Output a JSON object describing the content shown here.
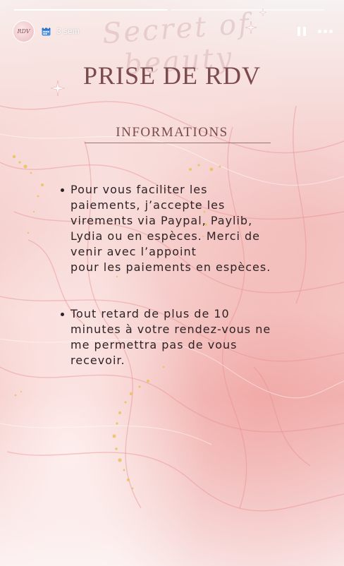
{
  "progress": {
    "segments": 2,
    "filled_fraction": [
      1.0,
      0.0
    ]
  },
  "header": {
    "avatar_text": "RDV",
    "calendar_icon": "calendar-icon",
    "time": "3 sem",
    "pause_icon": "pause-icon",
    "more_icon": "more-icon"
  },
  "story": {
    "watermark": "Secret of beauty",
    "title": "PRISE DE RDV",
    "subtitle": "INFORMATIONS",
    "bullets": [
      "Pour vous faciliter les\npaiements, j’accepte les\nvirements via Paypal, Paylib,\nLydia ou en espèces. Merci de\nvenir avec l’appoint\npour les paiements en espèces.",
      "Tout retard de plus de 10\nminutes à votre rendez-vous ne\nme permettra pas de vous\nrecevoir."
    ]
  },
  "colors": {
    "title": "#7a4a4c",
    "body_text": "#2e2224",
    "accent_gold": "#e8c25a",
    "background_pink": "#f4c6c4"
  }
}
